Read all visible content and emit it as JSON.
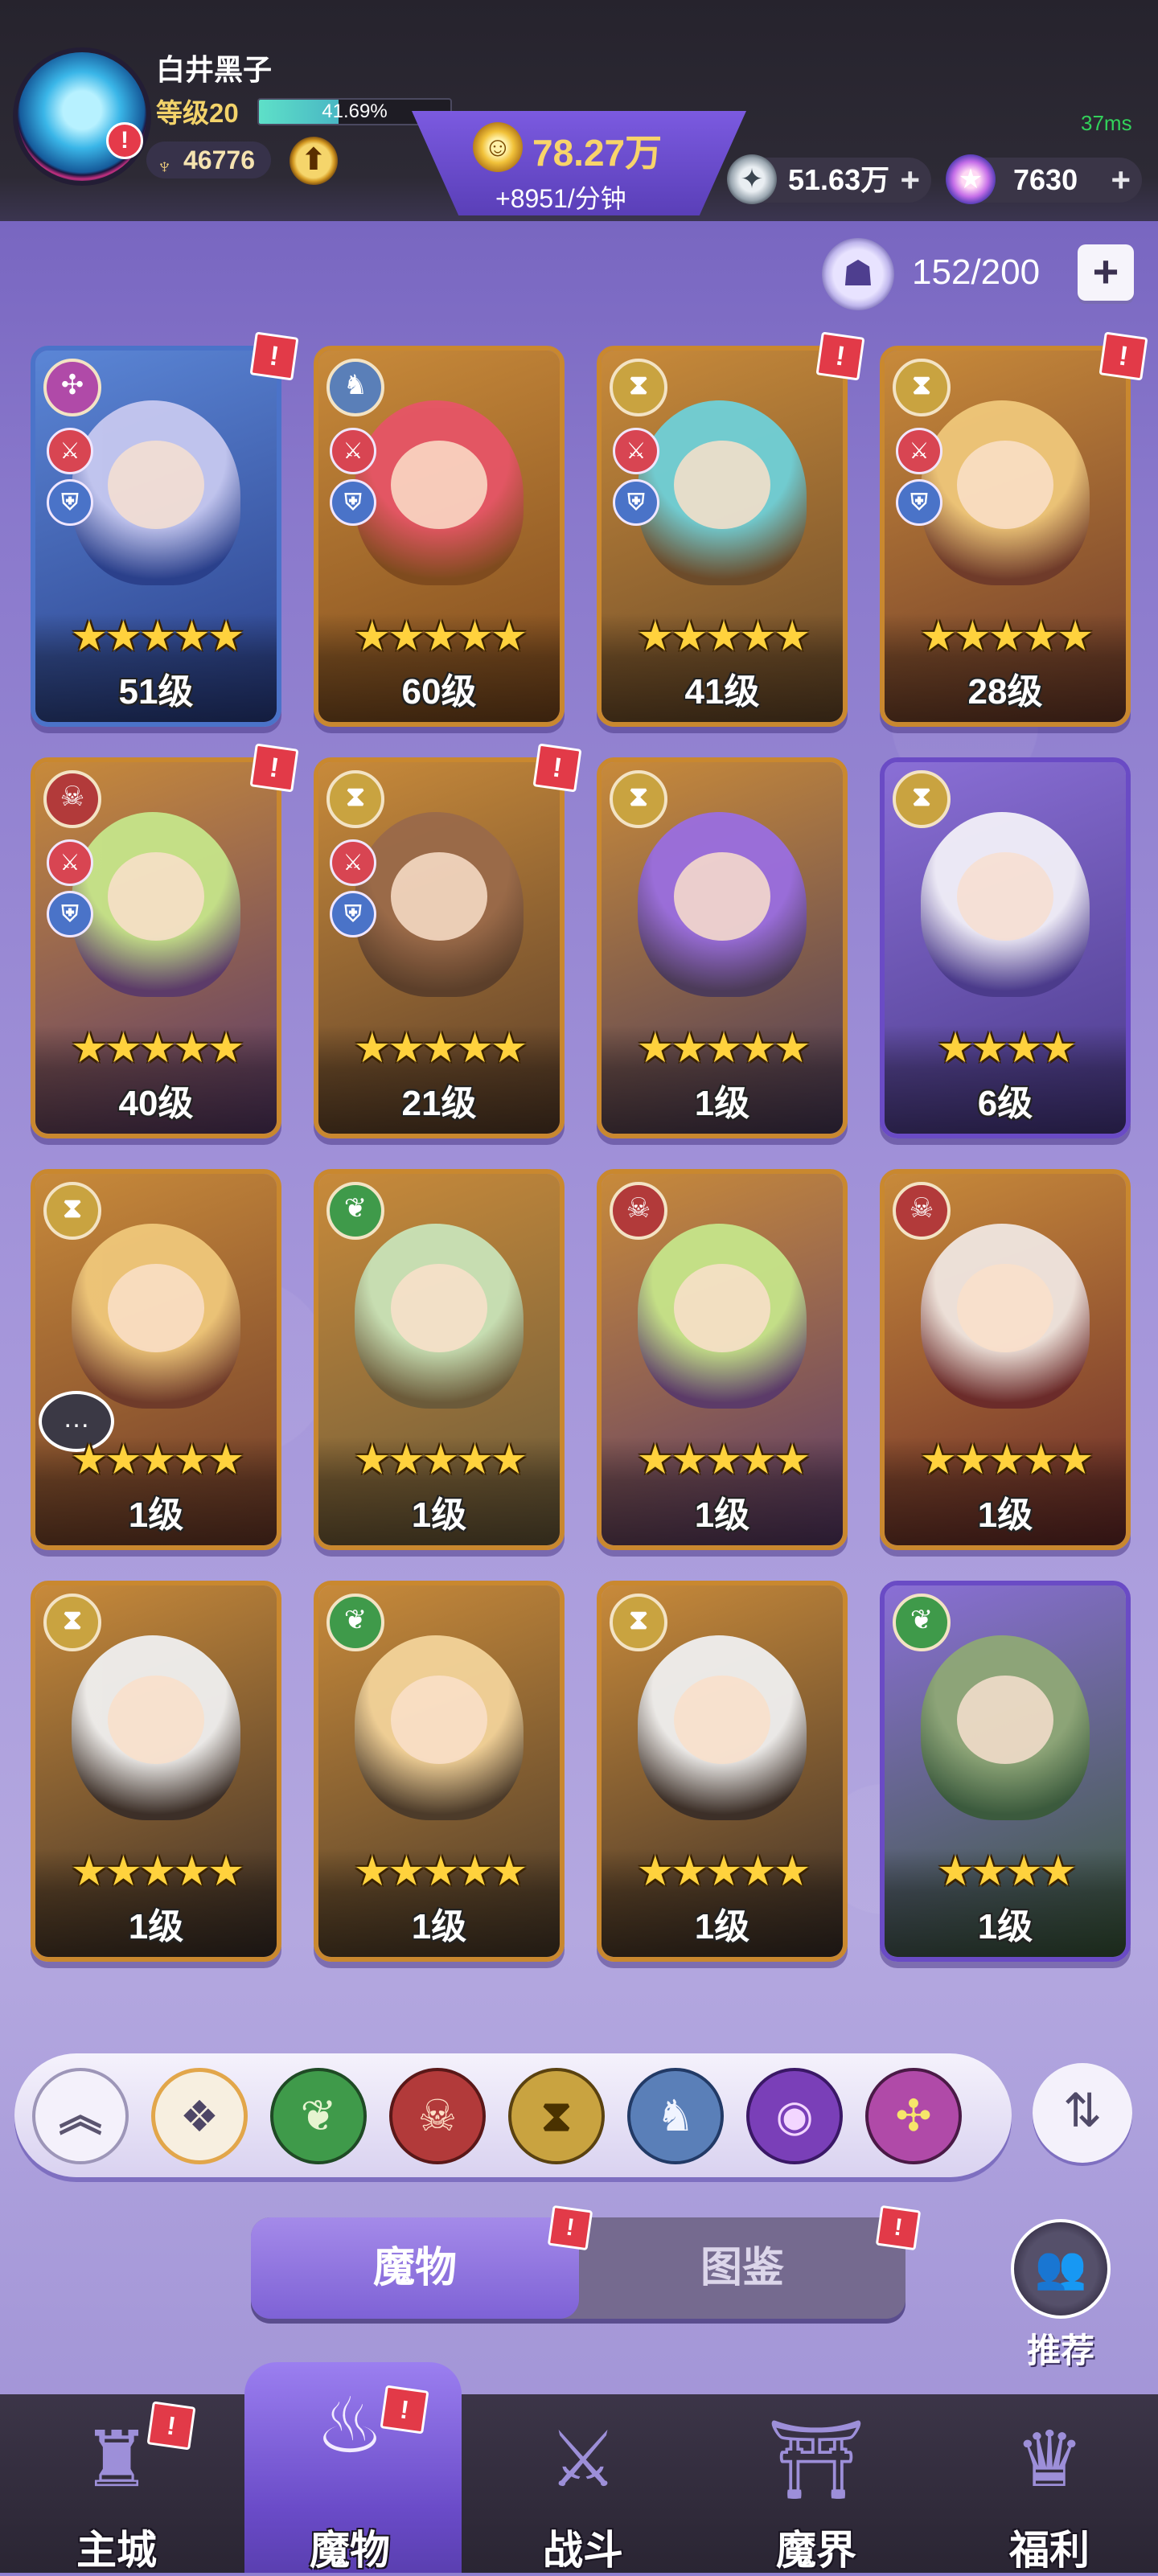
{
  "colors": {
    "accent_purple": "#7e62d6",
    "gold": "#f8d46a",
    "alert_red": "#e23a48",
    "ping_green": "#32d15a"
  },
  "header": {
    "player_name": "白井黑子",
    "player_level": "等级20",
    "exp_percent": "41.69%",
    "exp_fraction": 0.4169,
    "combat_power": "46776",
    "gold_total": "78.27万",
    "gold_rate": "+8951/分钟",
    "silver_total": "51.63万",
    "gems_total": "7630",
    "ping": "37ms",
    "icons": {
      "avatar": "player-avatar",
      "power": "trident-icon",
      "upgrade": "arrow-up-icon",
      "gold": "gold-coin-icon",
      "silver": "silver-coin-icon",
      "gem": "star-gem-icon"
    }
  },
  "inventory": {
    "count": "152/200",
    "icon": "monster-head-icon"
  },
  "cards": [
    {
      "level": "51级",
      "stars": "★★★★★",
      "faction": "void",
      "frame": "blue",
      "alert": true,
      "skills": [
        "sword",
        "shield"
      ]
    },
    {
      "level": "60级",
      "stars": "★★★★★",
      "faction": "dragon",
      "frame": "gold",
      "alert": false,
      "skills": [
        "sword",
        "shield"
      ]
    },
    {
      "level": "41级",
      "stars": "★★★★★",
      "faction": "time",
      "frame": "gold",
      "alert": true,
      "skills": [
        "sword",
        "shield"
      ]
    },
    {
      "level": "28级",
      "stars": "★★★★★",
      "faction": "time",
      "frame": "gold",
      "alert": true,
      "skills": [
        "sword",
        "shield"
      ]
    },
    {
      "level": "40级",
      "stars": "★★★★★",
      "faction": "demon",
      "frame": "gold",
      "alert": true,
      "skills": [
        "sword",
        "shield"
      ]
    },
    {
      "level": "21级",
      "stars": "★★★★★",
      "faction": "time",
      "frame": "gold",
      "alert": true,
      "skills": [
        "sword",
        "shield"
      ]
    },
    {
      "level": "1级",
      "stars": "★★★★★",
      "faction": "time",
      "frame": "gold",
      "alert": false,
      "skills": []
    },
    {
      "level": "6级",
      "stars": "★★★★",
      "faction": "time",
      "frame": "purple",
      "alert": false,
      "skills": []
    },
    {
      "level": "1级",
      "stars": "★★★★★",
      "faction": "time",
      "frame": "gold",
      "alert": false,
      "skills": [],
      "chat": true
    },
    {
      "level": "1级",
      "stars": "★★★★★",
      "faction": "nature",
      "frame": "gold",
      "alert": false,
      "skills": []
    },
    {
      "level": "1级",
      "stars": "★★★★★",
      "faction": "demon",
      "frame": "gold",
      "alert": false,
      "skills": []
    },
    {
      "level": "1级",
      "stars": "★★★★★",
      "faction": "demon",
      "frame": "gold",
      "alert": false,
      "skills": []
    },
    {
      "level": "1级",
      "stars": "★★★★★",
      "faction": "time",
      "frame": "gold",
      "alert": false,
      "skills": []
    },
    {
      "level": "1级",
      "stars": "★★★★★",
      "faction": "nature",
      "frame": "gold",
      "alert": false,
      "skills": []
    },
    {
      "level": "1级",
      "stars": "★★★★★",
      "faction": "time",
      "frame": "gold",
      "alert": false,
      "skills": []
    },
    {
      "level": "1级",
      "stars": "★★★★",
      "faction": "nature",
      "frame": "purple",
      "alert": false,
      "skills": []
    }
  ],
  "filters": [
    {
      "name": "collapse",
      "icon": "double-chevron-up-icon"
    },
    {
      "name": "all",
      "icon": "diamond-grid-icon"
    },
    {
      "name": "nature",
      "icon": "leaf-icon"
    },
    {
      "name": "demon",
      "icon": "demon-mask-icon"
    },
    {
      "name": "time",
      "icon": "hourglass-icon"
    },
    {
      "name": "dragon",
      "icon": "dragon-icon"
    },
    {
      "name": "eye",
      "icon": "eye-icon"
    },
    {
      "name": "void",
      "icon": "pinwheel-icon"
    }
  ],
  "sort_icon": "sort-icon",
  "tabs": {
    "monsters": "魔物",
    "codex": "图鉴"
  },
  "recommend": {
    "label": "推荐",
    "icon": "group-icon"
  },
  "bottom_nav": [
    {
      "label": "主城",
      "icon": "castle-icon",
      "alert": true
    },
    {
      "label": "魔物",
      "icon": "flame-spirit-icon",
      "alert": true,
      "active": true
    },
    {
      "label": "战斗",
      "icon": "sword-shield-icon",
      "alert": false
    },
    {
      "label": "魔界",
      "icon": "portal-icon",
      "alert": false
    },
    {
      "label": "福利",
      "icon": "treasure-chest-icon",
      "alert": false
    }
  ]
}
